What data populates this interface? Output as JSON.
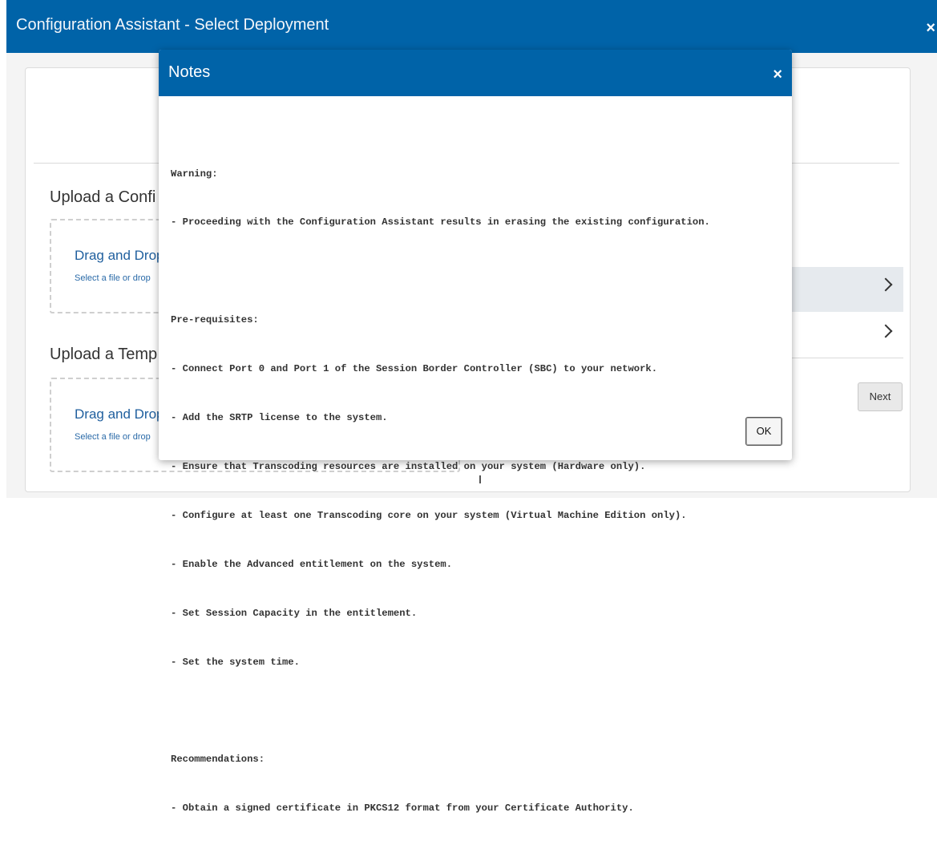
{
  "window": {
    "title": "Configuration Assistant - Select Deployment",
    "close_glyph": "×"
  },
  "background": {
    "upload_config_title": "Upload a Confi",
    "upload_config_dz_title": "Drag and Drop",
    "upload_config_dz_sub": "Select a file or drop",
    "upload_template_title": "Upload a Temp",
    "upload_template_dz_title": "Drag and Drop",
    "upload_template_dz_sub": "Select a file or drop",
    "next_label": "Next"
  },
  "modal": {
    "title": "Notes",
    "close_glyph": "×",
    "lines": [
      "Warning:",
      "- Proceeding with the Configuration Assistant results in erasing the existing configuration.",
      "",
      "Pre-requisites:",
      "- Connect Port 0 and Port 1 of the Session Border Controller (SBC) to your network.",
      "- Add the SRTP license to the system.",
      "- Ensure that Transcoding resources are installed on your system (Hardware only).",
      "- Configure at least one Transcoding core on your system (Virtual Machine Edition only).",
      "- Enable the Advanced entitlement on the system.",
      "- Set Session Capacity in the entitlement.",
      "- Set the system time.",
      "",
      "Recommendations:",
      "- Obtain a signed certificate in PKCS12 format from your Certificate Authority."
    ],
    "ok_label": "OK"
  },
  "colors": {
    "header_blue": "#0063a8",
    "link_blue": "#1f5f9e",
    "selected_row": "#e6eaee"
  }
}
